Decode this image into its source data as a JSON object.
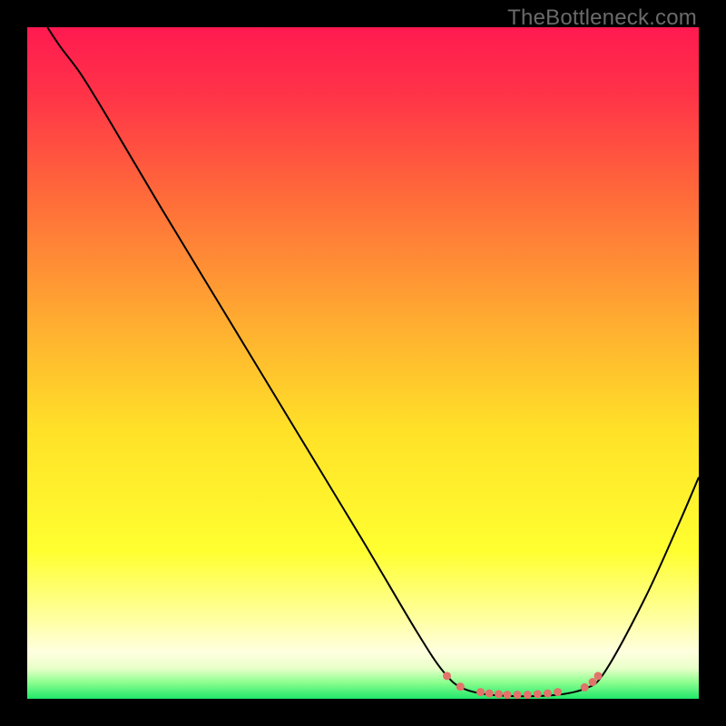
{
  "watermark": "TheBottleneck.com",
  "chart_data": {
    "type": "line",
    "title": "",
    "xlabel": "",
    "ylabel": "",
    "xlim": [
      0,
      100
    ],
    "ylim": [
      0,
      100
    ],
    "grid": false,
    "legend": false,
    "gradient_stops": [
      {
        "offset": 0.0,
        "color": "#ff1a50"
      },
      {
        "offset": 0.1,
        "color": "#ff3348"
      },
      {
        "offset": 0.25,
        "color": "#ff6a3a"
      },
      {
        "offset": 0.45,
        "color": "#ffb030"
      },
      {
        "offset": 0.6,
        "color": "#ffe128"
      },
      {
        "offset": 0.78,
        "color": "#ffff30"
      },
      {
        "offset": 0.88,
        "color": "#ffffa0"
      },
      {
        "offset": 0.93,
        "color": "#ffffe0"
      },
      {
        "offset": 0.955,
        "color": "#e8ffc8"
      },
      {
        "offset": 0.975,
        "color": "#8fff90"
      },
      {
        "offset": 1.0,
        "color": "#20e86a"
      }
    ],
    "series": [
      {
        "name": "bottleneck-curve",
        "color": "#000000",
        "width": 2,
        "points": [
          {
            "x": 3.0,
            "y": 100.0
          },
          {
            "x": 5.0,
            "y": 97.0
          },
          {
            "x": 8.0,
            "y": 93.0
          },
          {
            "x": 12.0,
            "y": 86.5
          },
          {
            "x": 20.0,
            "y": 73.0
          },
          {
            "x": 30.0,
            "y": 56.5
          },
          {
            "x": 40.0,
            "y": 40.0
          },
          {
            "x": 50.0,
            "y": 23.5
          },
          {
            "x": 58.0,
            "y": 10.0
          },
          {
            "x": 62.0,
            "y": 4.0
          },
          {
            "x": 65.0,
            "y": 1.5
          },
          {
            "x": 70.0,
            "y": 0.5
          },
          {
            "x": 78.0,
            "y": 0.5
          },
          {
            "x": 83.0,
            "y": 1.5
          },
          {
            "x": 86.0,
            "y": 4.0
          },
          {
            "x": 92.0,
            "y": 15.0
          },
          {
            "x": 97.0,
            "y": 26.0
          },
          {
            "x": 100.0,
            "y": 33.0
          }
        ]
      }
    ],
    "valley_markers": {
      "color": "#e2736b",
      "radius": 4.5,
      "points": [
        {
          "x": 62.5,
          "y": 3.4
        },
        {
          "x": 64.5,
          "y": 1.8
        },
        {
          "x": 67.5,
          "y": 1.0
        },
        {
          "x": 68.8,
          "y": 0.8
        },
        {
          "x": 70.2,
          "y": 0.7
        },
        {
          "x": 71.5,
          "y": 0.6
        },
        {
          "x": 73.0,
          "y": 0.6
        },
        {
          "x": 74.5,
          "y": 0.6
        },
        {
          "x": 76.0,
          "y": 0.7
        },
        {
          "x": 77.5,
          "y": 0.8
        },
        {
          "x": 79.0,
          "y": 1.0
        },
        {
          "x": 83.0,
          "y": 1.7
        },
        {
          "x": 84.2,
          "y": 2.5
        },
        {
          "x": 85.0,
          "y": 3.4
        }
      ]
    }
  }
}
